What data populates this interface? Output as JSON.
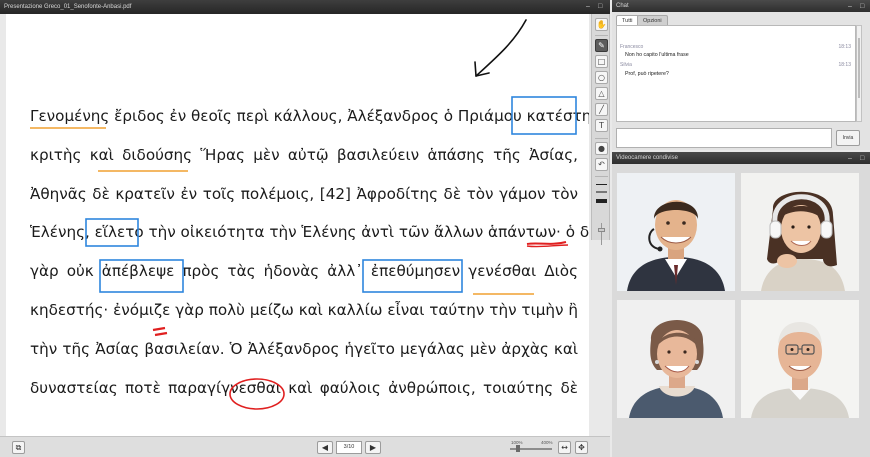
{
  "document": {
    "title": "Presentazione Greco_01_Senofonte-Anbasi.pdf",
    "lines": [
      "Γενομένης ἔριδος ἐν θεοῖς περὶ κάλλους, Ἀλέξανδρος ὁ Πριάμου κατέστη",
      "κριτὴς καὶ διδούσης Ἥρας μὲν αὐτῷ βασιλεύειν ἁπάσης τῆς Ἀσίας,",
      "Ἀθηνᾶς δὲ κρατεῖν ἐν τοῖς πολέμοις, [42] Ἀφροδίτης δὲ τὸν γάμον τὸν",
      "Ἑλένης, εἵλετο τὴν οἰκειότητα τὴν Ἑλένης ἀντὶ τῶν ἄλλων ἁπάντων· ὁ δὲ",
      "γὰρ οὐκ ἀπέβλεψε πρὸς τὰς ἡδονὰς ἀλλ᾽ ἐπεθύμησεν γενέσθαι Διὸς",
      "κηδεστής· ἐνόμιζε γὰρ πολὺ μείζω καὶ καλλίω εἶναι ταύτην  τὴν τιμὴν ἢ",
      "τὴν τῆς Ἀσίας βασιλείαν. Ὁ Ἀλέξανδρος ἡγεῖτο μεγάλας μὲν ἀρχὰς καὶ",
      "δυναστείας ποτὲ παραγίγνεσθαι καὶ φαύλοις ἀνθρώποις, τοιαύτης δὲ"
    ],
    "annotation_colors": {
      "box": "#2e86de",
      "underline": "#f0a030",
      "red": "#e02020",
      "arrow": "#111111"
    }
  },
  "toolbar": {
    "tools": [
      "hand-icon",
      "pen-icon",
      "square-icon",
      "circle-icon",
      "triangle-icon",
      "line-icon",
      "text-icon",
      "record-icon",
      "undo-icon"
    ]
  },
  "navigation": {
    "page_indicator": "3/10",
    "prev_icon": "◀",
    "next_icon": "▶",
    "zoom_min": "100%",
    "zoom_max": "400%"
  },
  "chat": {
    "title": "Chat",
    "tabs": [
      "Tutti",
      "Opzioni"
    ],
    "messages": [
      {
        "author": "Francesco",
        "time": "18:13",
        "text": "Non ho capito l'ultima frase"
      },
      {
        "author": "Silvia",
        "time": "18:13",
        "text": "Prof, può ripetere?"
      }
    ],
    "input_value": "",
    "send_label": "Invia"
  },
  "webcams": {
    "title": "Videocamere condivise",
    "participants": [
      {
        "name": "participant-1"
      },
      {
        "name": "participant-2"
      },
      {
        "name": "participant-3"
      },
      {
        "name": "participant-4"
      }
    ]
  }
}
